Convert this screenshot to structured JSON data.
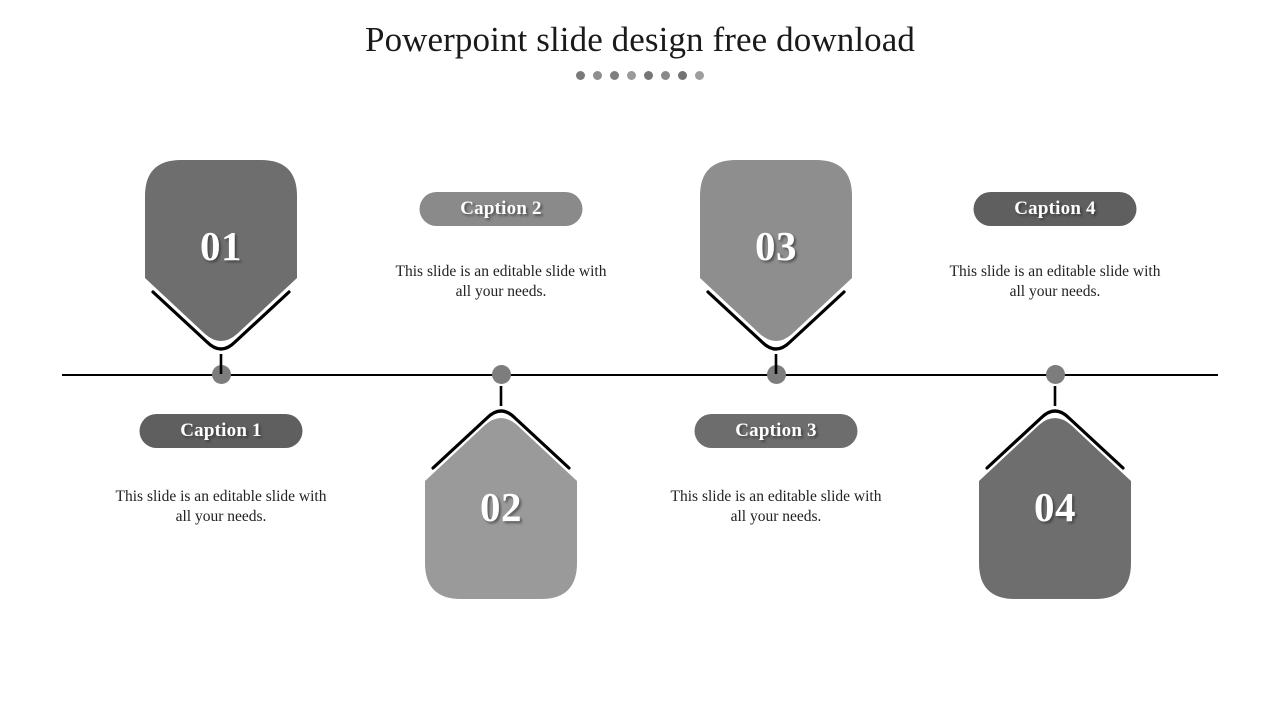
{
  "slide": {
    "title": "Powerpoint slide design free download",
    "background_color": "#ffffff",
    "title_dots": {
      "count": 8,
      "colors": [
        "#7a7a7a",
        "#8e8e8e",
        "#7f7f7f",
        "#9a9a9a",
        "#767676",
        "#8a8a8a",
        "#737373",
        "#9e9e9e"
      ]
    },
    "timeline": {
      "line_color": "#000000",
      "dot_color": "#7d7d7d"
    }
  },
  "milestones": [
    {
      "number": "01",
      "caption": "Caption 1",
      "body": "This slide is an editable slide with all your needs.",
      "shape_color": "#6e6e6e",
      "caption_color": "#5f5f5f",
      "position": "above"
    },
    {
      "number": "02",
      "caption": "Caption 2",
      "body": "This slide is an editable slide with all your needs.",
      "shape_color": "#9a9a9a",
      "caption_color": "#8a8a8a",
      "position": "below"
    },
    {
      "number": "03",
      "caption": "Caption 3",
      "body": "This slide is an editable slide with all your needs.",
      "shape_color": "#8e8e8e",
      "caption_color": "#6d6d6d",
      "position": "above"
    },
    {
      "number": "04",
      "caption": "Caption 4",
      "body": "This slide is an editable slide with all your needs.",
      "shape_color": "#6e6e6e",
      "caption_color": "#5f5f5f",
      "position": "below"
    }
  ]
}
